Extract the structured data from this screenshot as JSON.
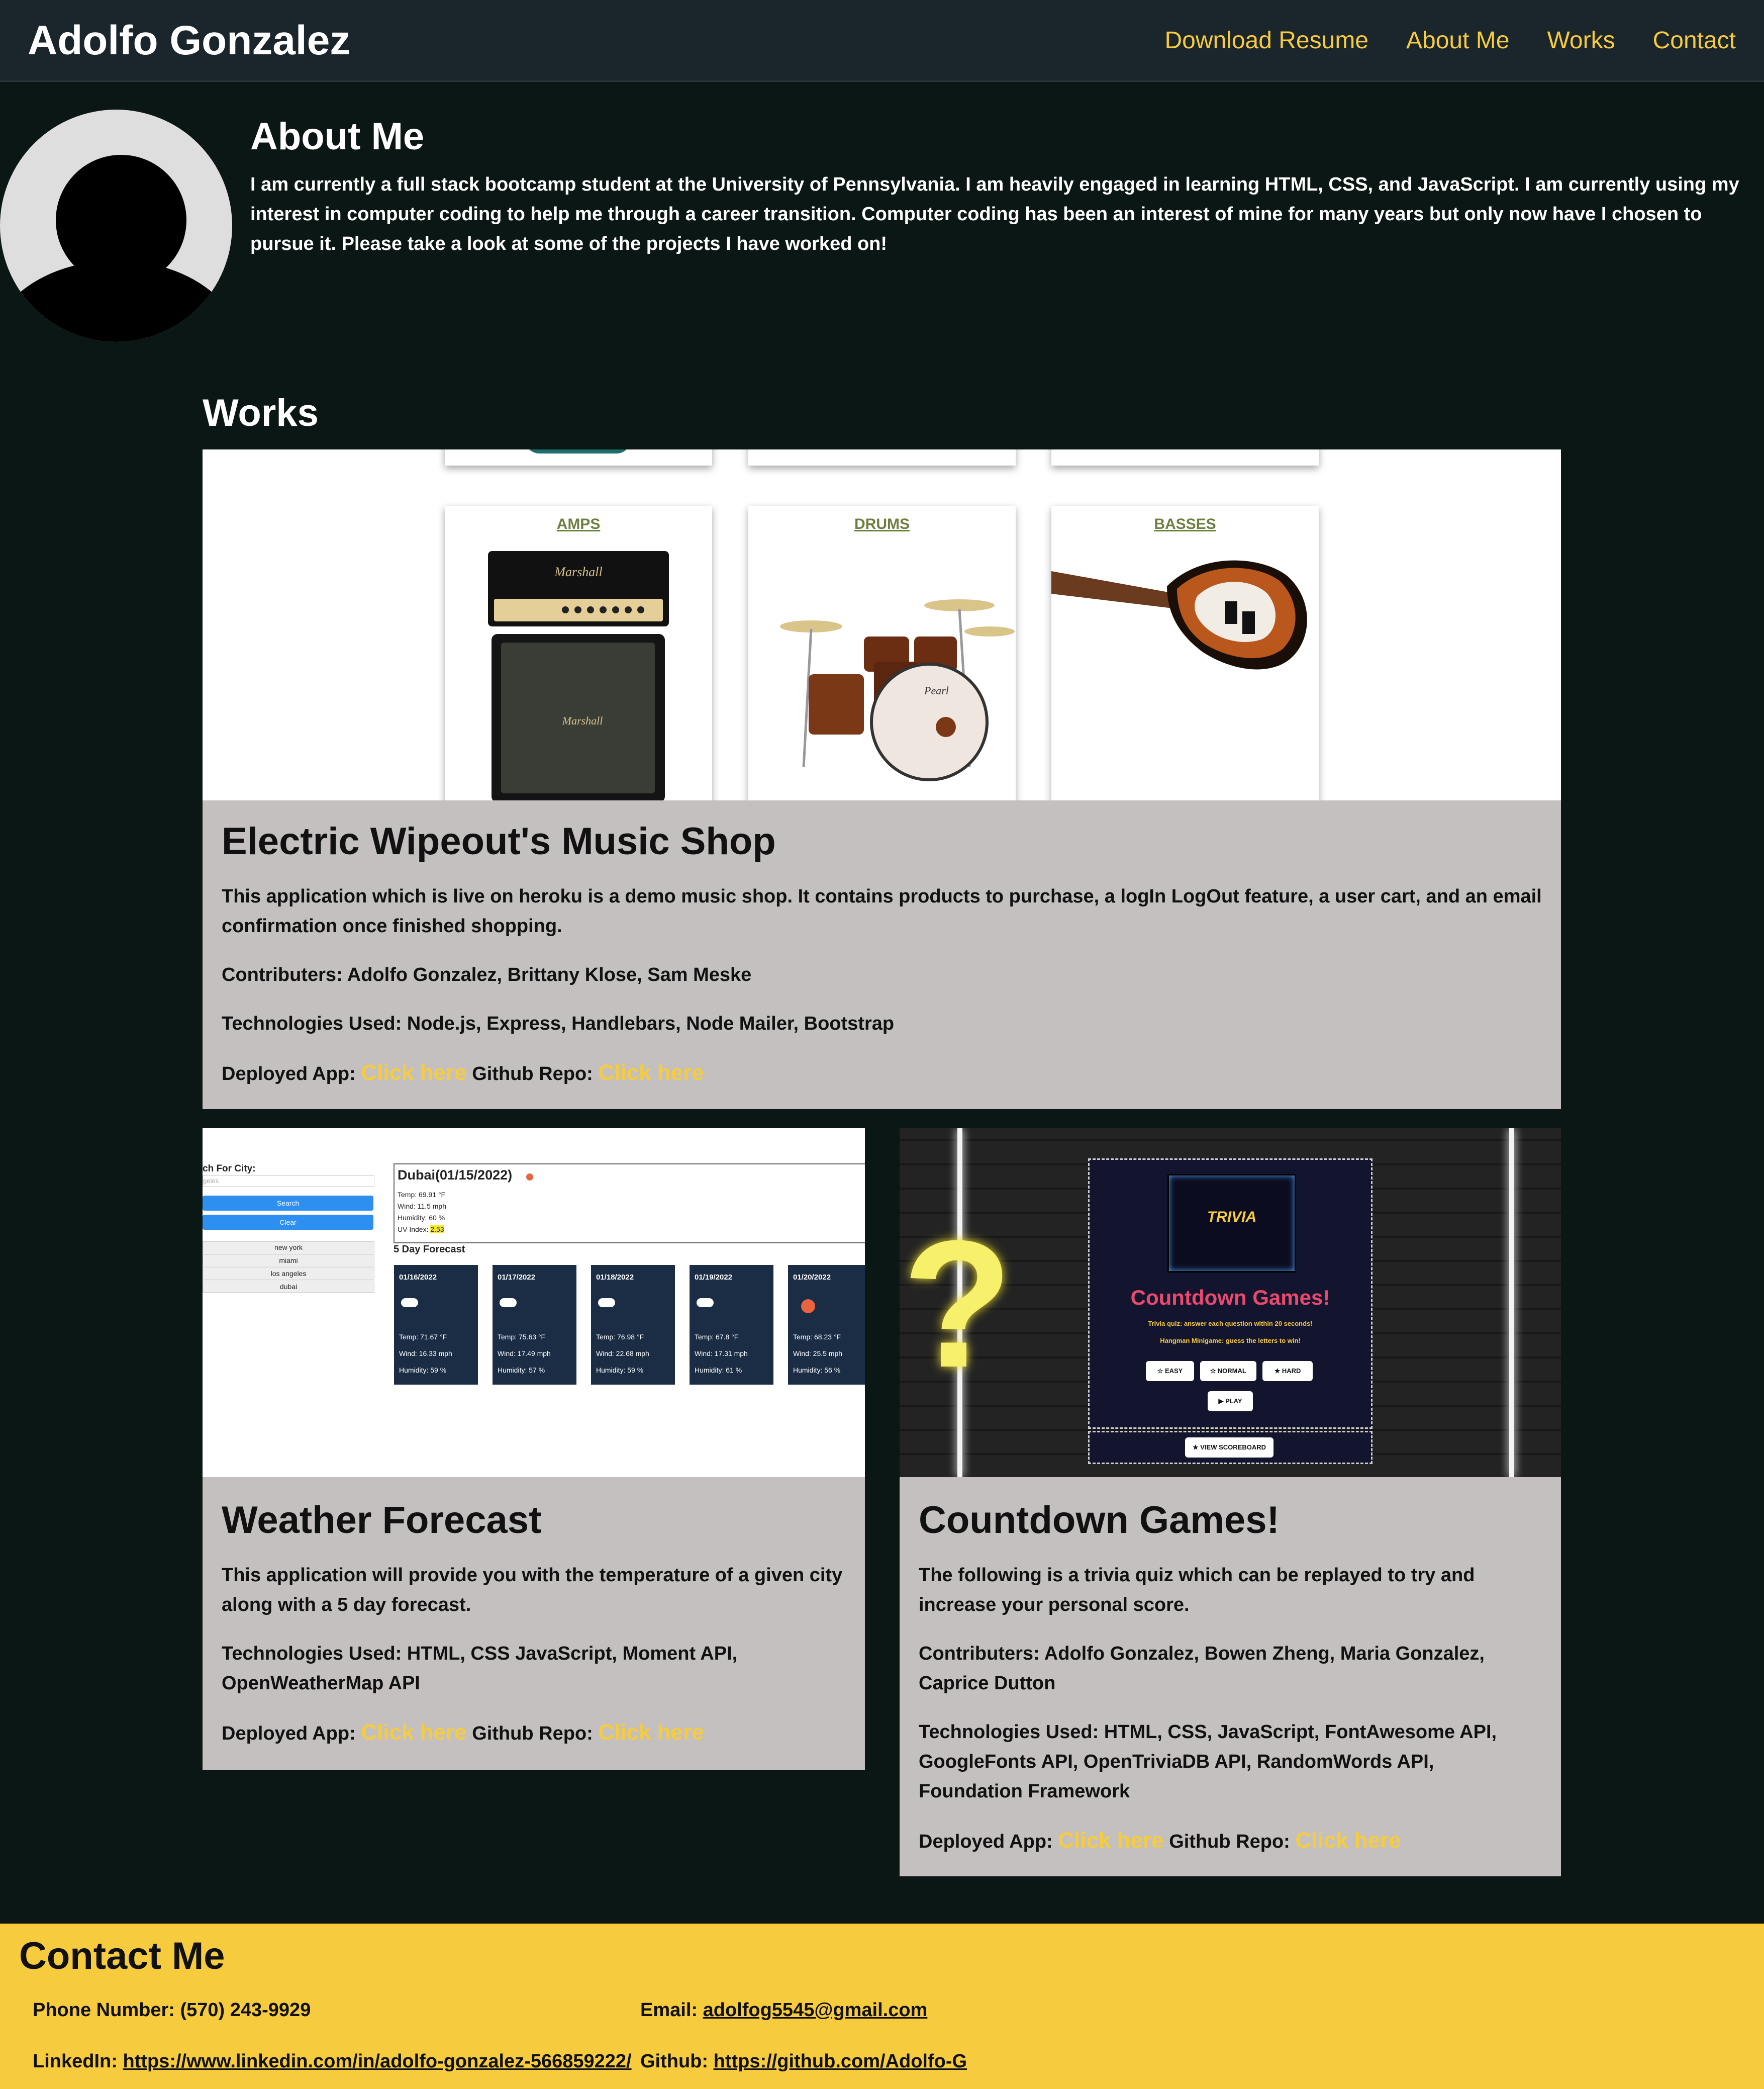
{
  "header": {
    "title": "Adolfo Gonzalez",
    "nav": [
      "Download Resume",
      "About Me",
      "Works",
      "Contact"
    ]
  },
  "about": {
    "title": "About Me",
    "text": "I am currently a full stack bootcamp student at the University of Pennsylvania. I am heavily engaged in learning HTML, CSS, and JavaScript. I am currently using my interest in computer coding to help me through a career transition. Computer coding has been an interest of mine for many years but only now have I chosen to pursue it. Please take a look at some of the projects I have worked on!"
  },
  "works": {
    "title": "Works",
    "deployed_label": "Deployed App:",
    "repo_label": "Github Repo:",
    "link_text": "Click here",
    "projects": [
      {
        "title": "Electric Wipeout's Music Shop",
        "description": "This application which is live on heroku is a demo music shop. It contains products to purchase, a logIn LogOut feature, a user cart, and an email confirmation once finished shopping.",
        "contributors": "Contributers: Adolfo Gonzalez, Brittany Klose, Sam Meske",
        "technologies": "Technologies Used: Node.js, Express, Handlebars, Node Mailer, Bootstrap",
        "screenshot": {
          "tiles": [
            "AMPS",
            "DRUMS",
            "BASSES"
          ]
        }
      },
      {
        "title": "Weather Forecast",
        "description": "This application will provide you with the temperature of a given city along with a 5 day forecast.",
        "technologies": "Technologies Used: HTML, CSS JavaScript, Moment API, OpenWeatherMap API",
        "screenshot": {
          "search_label": "ch For City:",
          "search_placeholder": "geles",
          "search_btn": "Search",
          "clear_btn": "Clear",
          "history": [
            "new york",
            "miami",
            "los angeles",
            "dubai"
          ],
          "city": "Dubai(01/15/2022)",
          "current": [
            "Temp: 69.91 °F",
            "Wind: 11.5 mph",
            "Humidity: 60 %"
          ],
          "uv_label": "UV Index:",
          "uv_value": "2.53",
          "forecast_title": "5 Day Forecast",
          "forecast": [
            {
              "date": "01/16/2022",
              "temp": "Temp: 71.67 °F",
              "wind": "Wind: 16.33 mph",
              "hum": "Humidity: 59 %"
            },
            {
              "date": "01/17/2022",
              "temp": "Temp: 75.63 °F",
              "wind": "Wind: 17.49 mph",
              "hum": "Humidity: 57 %"
            },
            {
              "date": "01/18/2022",
              "temp": "Temp: 76.98 °F",
              "wind": "Wind: 22.68 mph",
              "hum": "Humidity: 59 %"
            },
            {
              "date": "01/19/2022",
              "temp": "Temp: 67.8 °F",
              "wind": "Wind: 17.31 mph",
              "hum": "Humidity: 61 %"
            },
            {
              "date": "01/20/2022",
              "temp": "Temp: 68.23 °F",
              "wind": "Wind: 25.5 mph",
              "hum": "Humidity: 56 %"
            }
          ]
        }
      },
      {
        "title": "Countdown Games!",
        "description": "The following is a trivia quiz which can be replayed to try and increase your personal score.",
        "contributors": "Contributers: Adolfo Gonzalez, Bowen Zheng, Maria Gonzalez, Caprice Dutton",
        "technologies": "Technologies Used: HTML, CSS, JavaScript, FontAwesome API, GoogleFonts API, OpenTriviaDB API, RandomWords API, Foundation Framework",
        "screenshot": {
          "logo_text": "TRIVIA",
          "title": "Countdown Games!",
          "line1": "Trivia quiz: answer each question within 20 seconds!",
          "line2": "Hangman Minigame: guess the letters to win!",
          "buttons": [
            "EASY",
            "NORMAL",
            "HARD"
          ],
          "play": "PLAY",
          "scoreboard": "VIEW SCOREBOARD"
        }
      }
    ]
  },
  "contact": {
    "title": "Contact Me",
    "phone_label": "Phone Number:",
    "phone": "(570) 243-9929",
    "email_label": "Email:",
    "email": "adolfog5545@gmail.com",
    "linkedin_label": "LinkedIn:",
    "linkedin": "https://www.linkedin.com/in/adolfo-gonzalez-566859222/",
    "github_label": "Github:",
    "github": "https://github.com/Adolfo-G"
  },
  "colors": {
    "background": "#0b1714",
    "header": "#1b252c",
    "accent": "#f6cc3e",
    "card": "#c4c0bf"
  }
}
